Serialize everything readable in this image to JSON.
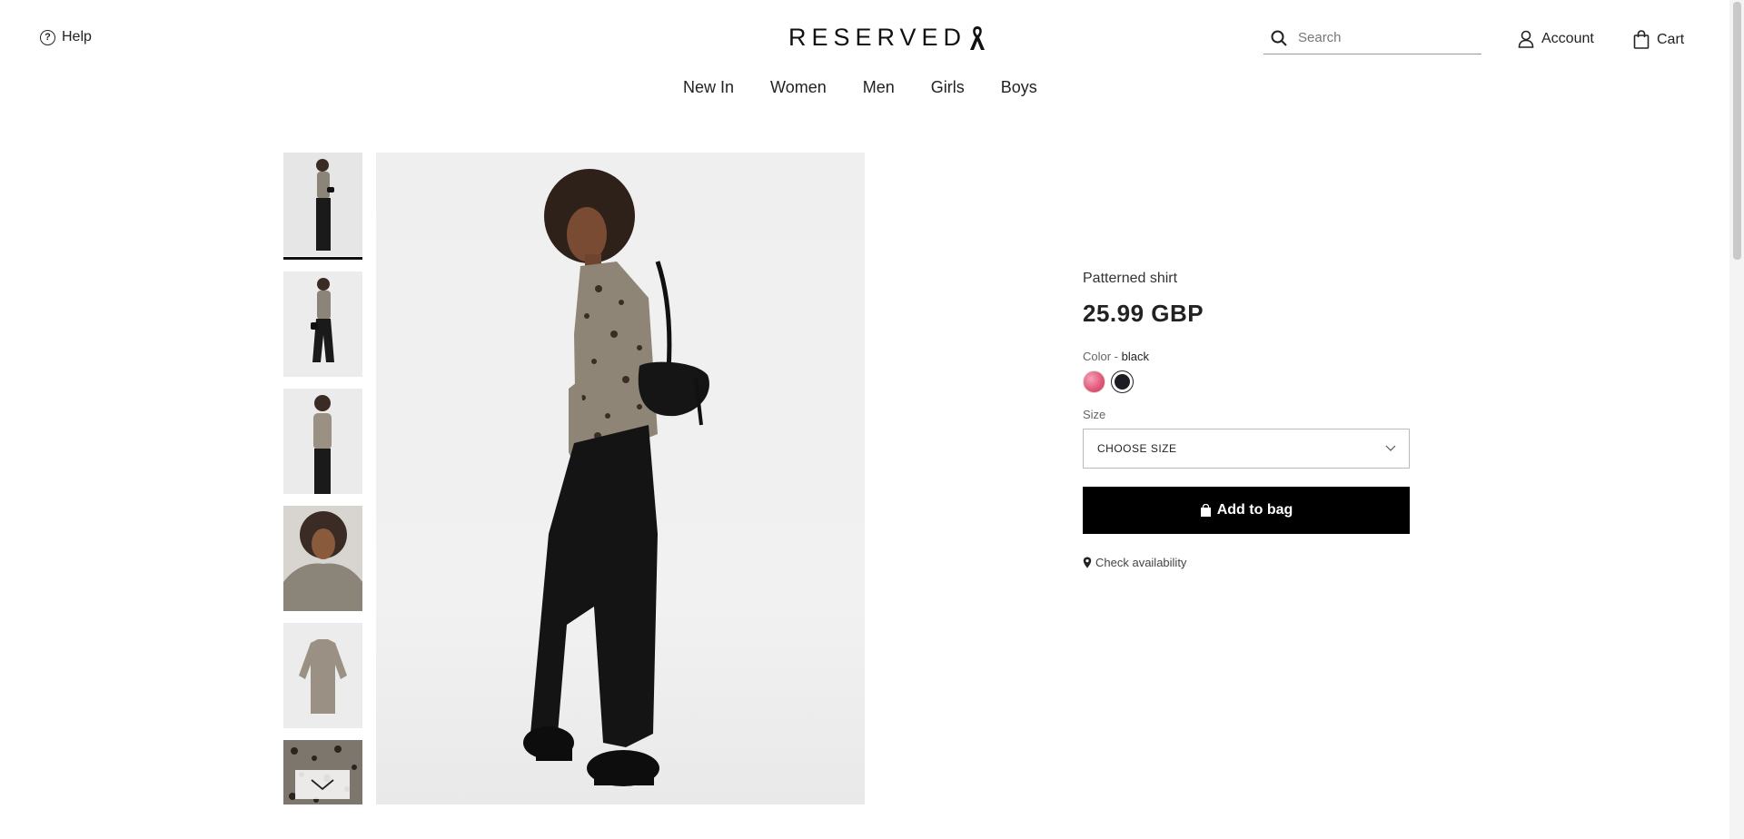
{
  "header": {
    "help_label": "Help",
    "logo_text": "RESERVED",
    "search_placeholder": "Search",
    "account_label": "Account",
    "cart_label": "Cart"
  },
  "nav": {
    "items": [
      "New In",
      "Women",
      "Men",
      "Girls",
      "Boys"
    ]
  },
  "gallery": {
    "thumbnail_count": 6,
    "active_index": 0
  },
  "product": {
    "name": "Patterned shirt",
    "price": "25.99 GBP",
    "color_label": "Color -",
    "color_value": "black",
    "swatches": [
      {
        "name": "pink",
        "color": "#e25a7c"
      },
      {
        "name": "black",
        "color": "#1c1c22"
      }
    ],
    "size_label": "Size",
    "size_select": "CHOOSE SIZE",
    "add_to_bag": "Add to bag",
    "check_availability": "Check availability"
  },
  "colors": {
    "primary_button": "#000000",
    "text": "#222222"
  }
}
